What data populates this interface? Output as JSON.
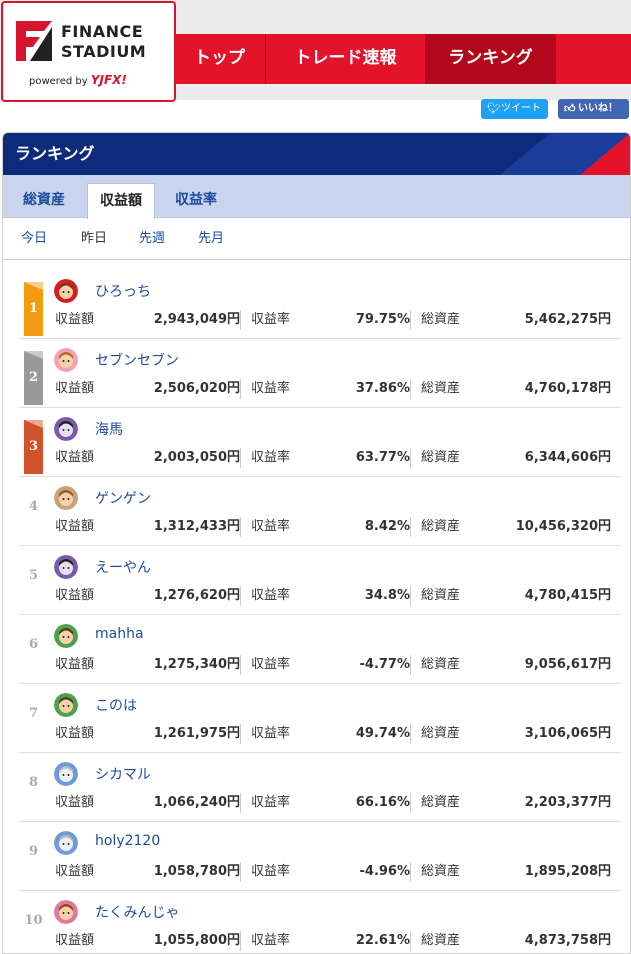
{
  "logo": {
    "line1": "FINANCE",
    "line2": "STADIUM",
    "powered": "powered by",
    "brand": "YJFX!"
  },
  "nav": {
    "items": [
      "トップ",
      "トレード速報",
      "ランキング"
    ]
  },
  "social": {
    "tweet": "ツイート",
    "like": "いいね！"
  },
  "panel": {
    "title": "ランキング",
    "tabs": [
      "総資産",
      "収益額",
      "収益率"
    ],
    "periods": [
      "今日",
      "昨日",
      "先週",
      "先月"
    ]
  },
  "labels": {
    "profit": "収益額",
    "rate": "収益率",
    "assets": "総資産"
  },
  "colors": {
    "rank1": "#f39c12",
    "rank2": "#999999",
    "rank3": "#d4522a",
    "nav": "#e2132b",
    "header": "#0d2b7a"
  },
  "rankings": [
    {
      "rank": "1",
      "name": "ひろっち",
      "avatar": "boy-red-avatar",
      "profit": "2,943,049円",
      "rate": "79.75%",
      "assets": "5,462,275円"
    },
    {
      "rank": "2",
      "name": "セブンセブン",
      "avatar": "girl-pink-avatar",
      "profit": "2,506,020円",
      "rate": "37.86%",
      "assets": "4,760,178円"
    },
    {
      "rank": "3",
      "name": "海馬",
      "avatar": "glasses-purple-avatar",
      "profit": "2,003,050円",
      "rate": "63.77%",
      "assets": "6,344,606円"
    },
    {
      "rank": "4",
      "name": "ゲンゲン",
      "avatar": "girl-brown-avatar",
      "profit": "1,312,433円",
      "rate": "8.42%",
      "assets": "10,456,320円"
    },
    {
      "rank": "5",
      "name": "えーやん",
      "avatar": "glasses-purple-avatar",
      "profit": "1,276,620円",
      "rate": "34.8%",
      "assets": "4,780,415円"
    },
    {
      "rank": "6",
      "name": "mahha",
      "avatar": "man-green-avatar",
      "profit": "1,275,340円",
      "rate": "-4.77%",
      "assets": "9,056,617円"
    },
    {
      "rank": "7",
      "name": "このは",
      "avatar": "man-green-avatar",
      "profit": "1,261,975円",
      "rate": "49.74%",
      "assets": "3,106,065円"
    },
    {
      "rank": "8",
      "name": "シカマル",
      "avatar": "elder-blue-avatar",
      "profit": "1,066,240円",
      "rate": "66.16%",
      "assets": "2,203,377円"
    },
    {
      "rank": "9",
      "name": "holy2120",
      "avatar": "elder-blue-avatar",
      "profit": "1,058,780円",
      "rate": "-4.96%",
      "assets": "1,895,208円"
    },
    {
      "rank": "10",
      "name": "たくみんじゃ",
      "avatar": "woman-pink-avatar",
      "profit": "1,055,800円",
      "rate": "22.61%",
      "assets": "4,873,758円"
    }
  ]
}
